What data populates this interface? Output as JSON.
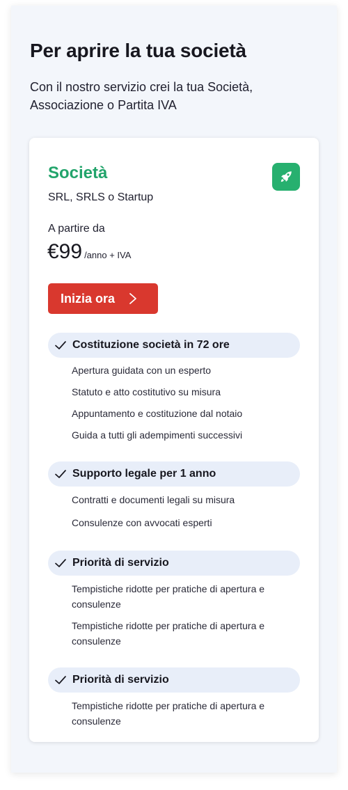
{
  "page": {
    "title": "Per aprire la tua società",
    "subtitle": "Con il nostro servizio crei la tua Società, Associazione o Partita IVA"
  },
  "card": {
    "title": "Società",
    "icon": "rocket-icon",
    "subtitle": "SRL, SRLS o Startup",
    "from_label": "A partire da",
    "price": "€99",
    "price_unit": "/anno + IVA",
    "cta_label": "Inizia ora",
    "cta_icon": "chevron-right-icon",
    "accent_color": "#22a46b",
    "cta_color": "#d9382e"
  },
  "sections": [
    {
      "label": "Costituzione società in 72 ore",
      "items": [
        "Apertura guidata con un esperto",
        "Statuto e atto costitutivo su misura",
        "Appuntamento e costituzione dal notaio",
        "Guida a tutti gli adempimenti successivi"
      ]
    },
    {
      "label": "Supporto legale per 1 anno",
      "items": [
        "Contratti e documenti legali su misura",
        "Consulenze con avvocati esperti"
      ]
    },
    {
      "label": "Priorità di servizio",
      "items": [
        "Tempistiche ridotte per pratiche di apertura e consulenze",
        "Tempistiche ridotte per pratiche di apertura e consulenze"
      ]
    },
    {
      "label": "Priorità di servizio",
      "items": [
        "Tempistiche ridotte per pratiche di apertura e consulenze"
      ]
    }
  ]
}
